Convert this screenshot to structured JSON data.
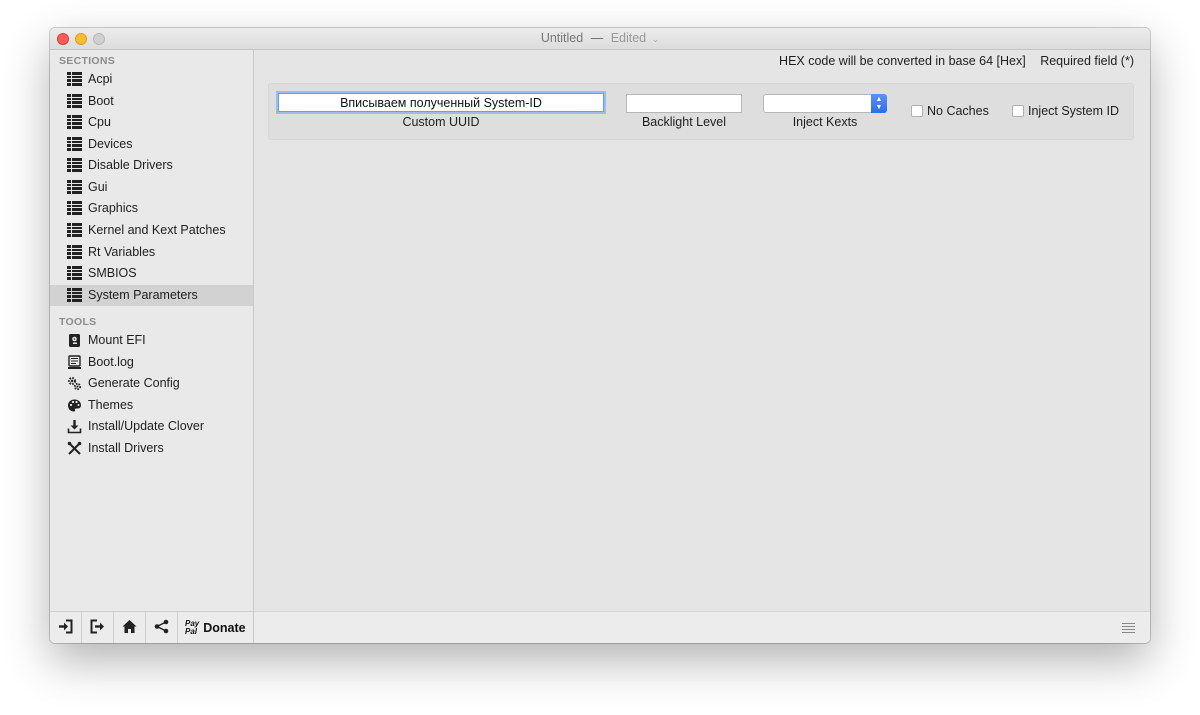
{
  "window": {
    "title": "Untitled",
    "separator": "—",
    "status": "Edited"
  },
  "sidebar": {
    "sections_header": "SECTIONS",
    "sections": [
      {
        "label": "Acpi",
        "icon": "list-icon"
      },
      {
        "label": "Boot",
        "icon": "list-icon"
      },
      {
        "label": "Cpu",
        "icon": "list-icon"
      },
      {
        "label": "Devices",
        "icon": "list-icon"
      },
      {
        "label": "Disable Drivers",
        "icon": "list-icon"
      },
      {
        "label": "Gui",
        "icon": "list-icon"
      },
      {
        "label": "Graphics",
        "icon": "list-icon"
      },
      {
        "label": "Kernel and Kext Patches",
        "icon": "list-icon"
      },
      {
        "label": "Rt Variables",
        "icon": "list-icon"
      },
      {
        "label": "SMBIOS",
        "icon": "list-icon"
      },
      {
        "label": "System Parameters",
        "icon": "list-icon",
        "selected": true
      }
    ],
    "tools_header": "TOOLS",
    "tools": [
      {
        "label": "Mount EFI",
        "icon": "disk-icon"
      },
      {
        "label": "Boot.log",
        "icon": "log-icon"
      },
      {
        "label": "Generate Config",
        "icon": "gears-icon"
      },
      {
        "label": "Themes",
        "icon": "palette-icon"
      },
      {
        "label": "Install/Update Clover",
        "icon": "download-icon"
      },
      {
        "label": "Install Drivers",
        "icon": "wrench-icon"
      }
    ],
    "footer": {
      "donate_brand_top": "Pay",
      "donate_brand_bottom": "Pal",
      "donate_label": "Donate"
    }
  },
  "content": {
    "hex_note": "HEX code will be converted in base 64 [Hex]",
    "required_note": "Required field (*)",
    "custom_uuid": {
      "value": "Вписываем полученный System-ID",
      "label": "Custom UUID"
    },
    "backlight_level": {
      "value": "",
      "label": "Backlight Level"
    },
    "inject_kexts": {
      "value": "",
      "label": "Inject Kexts"
    },
    "no_caches": {
      "label": "No Caches",
      "checked": false
    },
    "inject_system_id": {
      "label": "Inject System ID",
      "checked": false
    }
  },
  "colors": {
    "selection": "#d2d2d2",
    "focus_ring": "#98bdf3",
    "select_arrow": "#2f6de8"
  }
}
